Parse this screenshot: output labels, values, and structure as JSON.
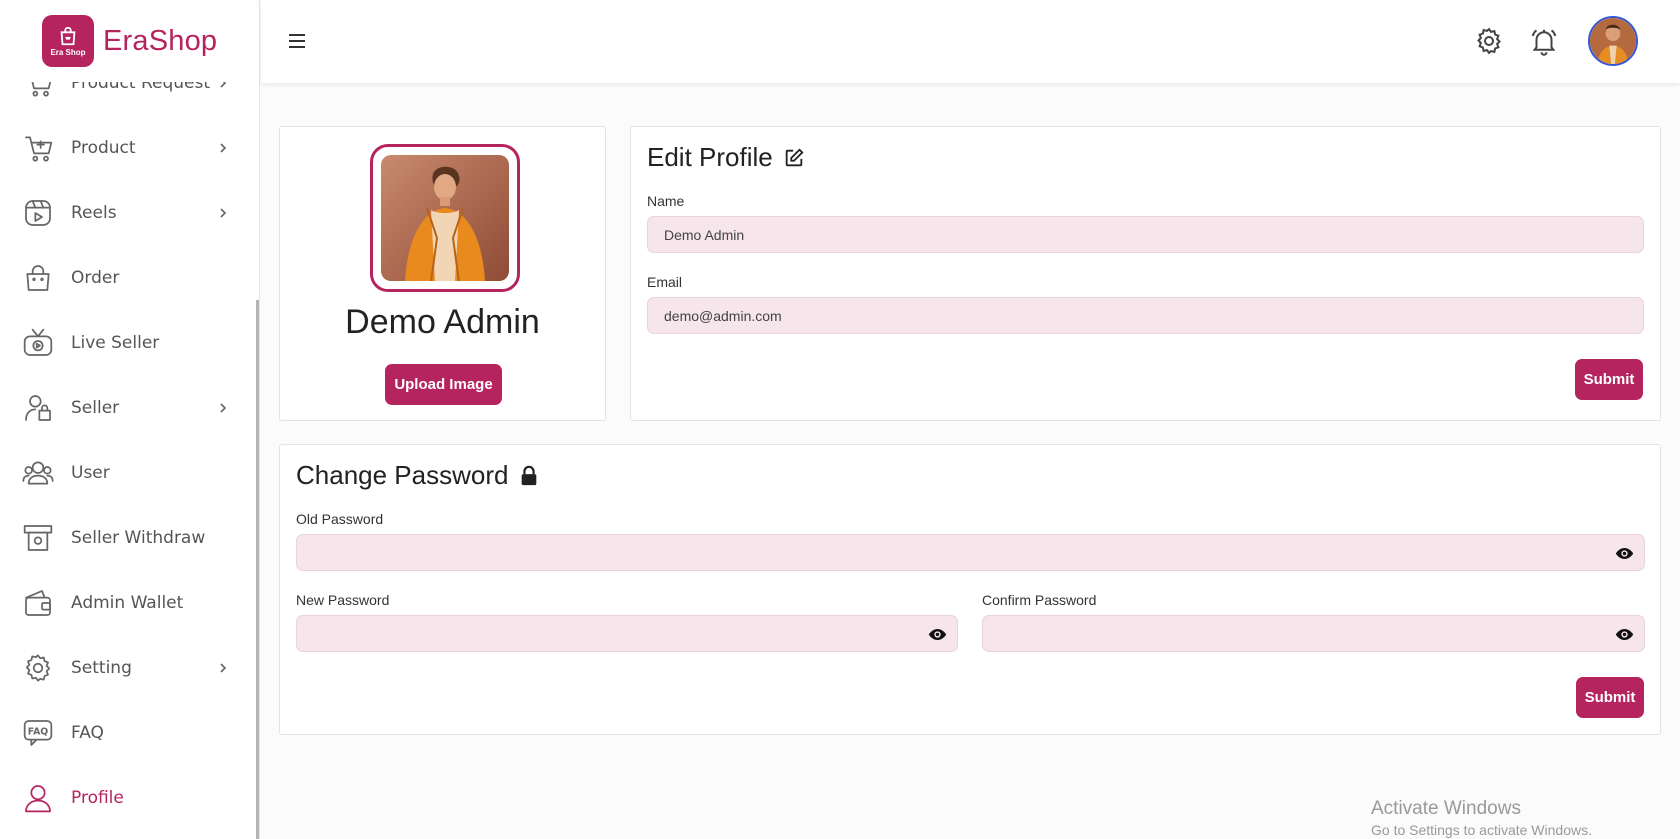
{
  "brand": {
    "name": "EraShop",
    "logo_caption": "Era Shop",
    "color": "#b5245f"
  },
  "sidebar": {
    "items": [
      {
        "label": "Product Request",
        "icon": "cart-icon",
        "chevron": true,
        "active": false
      },
      {
        "label": "Product",
        "icon": "cart-plus-icon",
        "chevron": true,
        "active": false
      },
      {
        "label": "Reels",
        "icon": "reels-icon",
        "chevron": true,
        "active": false
      },
      {
        "label": "Order",
        "icon": "shopping-bag-icon",
        "chevron": false,
        "active": false
      },
      {
        "label": "Live Seller",
        "icon": "live-tv-icon",
        "chevron": false,
        "active": false
      },
      {
        "label": "Seller",
        "icon": "seller-icon",
        "chevron": true,
        "active": false
      },
      {
        "label": "User",
        "icon": "users-icon",
        "chevron": false,
        "active": false
      },
      {
        "label": "Seller Withdraw",
        "icon": "withdraw-icon",
        "chevron": false,
        "active": false
      },
      {
        "label": "Admin Wallet",
        "icon": "wallet-icon",
        "chevron": false,
        "active": false
      },
      {
        "label": "Setting",
        "icon": "gear-icon",
        "chevron": true,
        "active": false
      },
      {
        "label": "FAQ",
        "icon": "faq-icon",
        "chevron": false,
        "active": false
      },
      {
        "label": "Profile",
        "icon": "user-icon",
        "chevron": false,
        "active": true
      }
    ]
  },
  "topbar": {
    "menu_icon": "hamburger-icon",
    "settings_icon": "gear-icon",
    "notification_icon": "bell-icon",
    "avatar_icon": "avatar"
  },
  "profile_card": {
    "name": "Demo Admin",
    "upload_label": "Upload Image"
  },
  "edit_profile": {
    "title": "Edit Profile",
    "name_label": "Name",
    "name_value": "Demo Admin",
    "email_label": "Email",
    "email_value": "demo@admin.com",
    "submit_label": "Submit"
  },
  "change_password": {
    "title": "Change Password",
    "old_label": "Old Password",
    "old_value": "",
    "new_label": "New Password",
    "new_value": "",
    "confirm_label": "Confirm Password",
    "confirm_value": "",
    "submit_label": "Submit"
  },
  "watermark": {
    "line1": "Activate Windows",
    "line2": "Go to Settings to activate Windows."
  }
}
